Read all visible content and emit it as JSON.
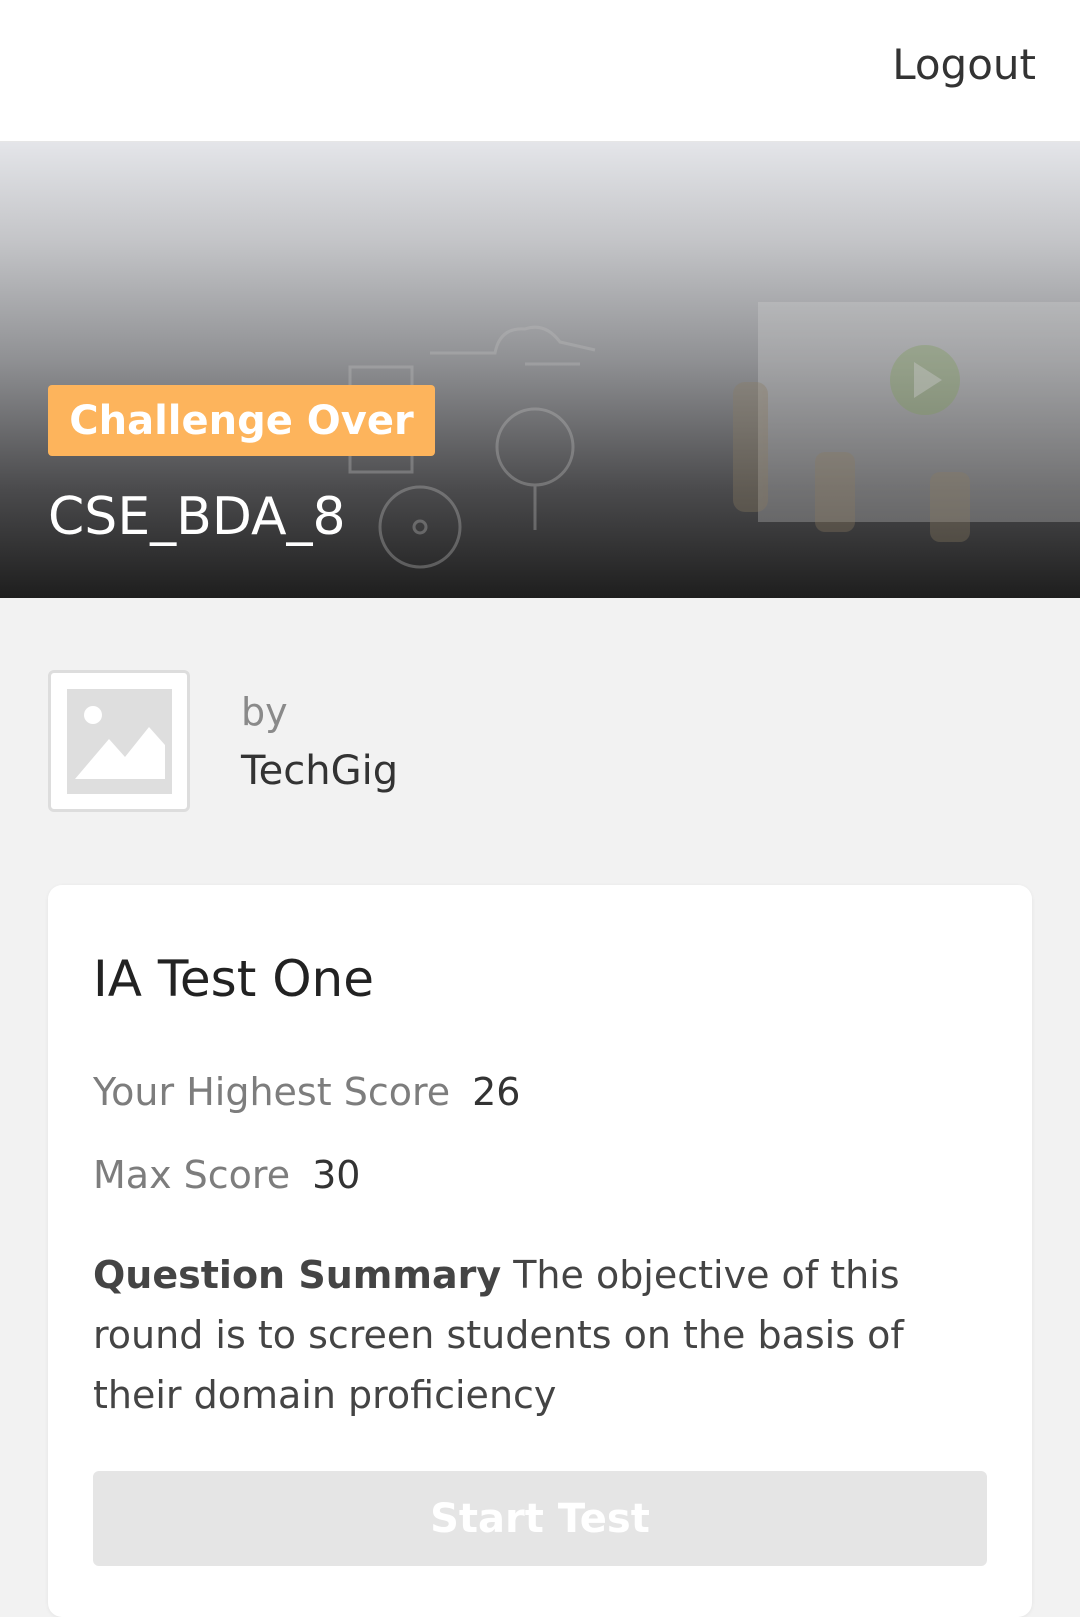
{
  "header": {
    "logout_label": "Logout"
  },
  "hero": {
    "status_badge": "Challenge Over",
    "challenge_title": "CSE_BDA_8"
  },
  "organizer": {
    "by_label": "by",
    "name": "TechGig"
  },
  "test_card": {
    "title": "IA Test One",
    "highest_score_label": "Your Highest Score",
    "highest_score_value": "26",
    "max_score_label": "Max Score",
    "max_score_value": "30",
    "summary_label": "Question Summary",
    "summary_text": "The objective of this round is to screen students on the basis of their domain proficiency",
    "start_button_label": "Start Test"
  },
  "colors": {
    "badge": "#fdb45c",
    "start_button_disabled": "#e5e5e5",
    "page_background": "#f2f2f2"
  },
  "icons": {
    "organizer_logo": "image-placeholder-icon"
  }
}
